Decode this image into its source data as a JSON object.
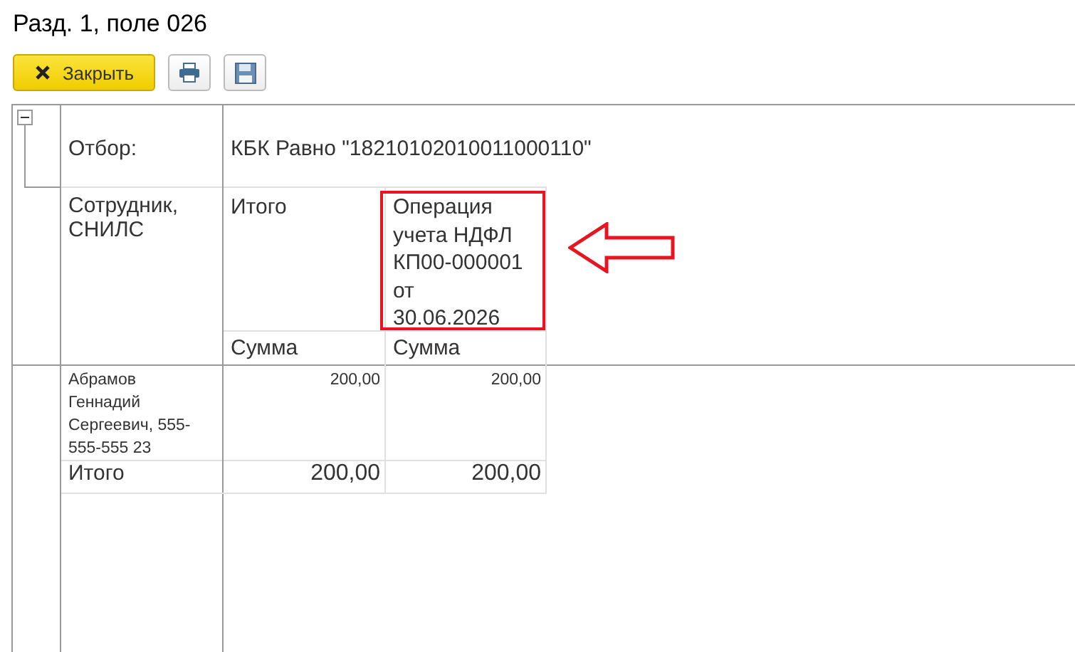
{
  "title": "Разд. 1, поле 026",
  "toolbar": [
    {
      "kind": "close",
      "label": "Закрыть"
    },
    {
      "kind": "print"
    },
    {
      "kind": "save"
    }
  ],
  "report": {
    "group_expanded": true,
    "filter_label": "Отбор:",
    "filter_value": "КБК Равно \"18210102010011000110\"",
    "row_header": "Сотрудник, СНИЛС",
    "columns": [
      {
        "title": "Итого",
        "measure": "Сумма",
        "highlighted": false
      },
      {
        "title": "Операция учета НДФЛ КП00-000001 от 30.06.2026",
        "measure": "Сумма",
        "highlighted": true
      }
    ],
    "rows": [
      {
        "name": "Абрамов Геннадий Сергеевич, 555-555-555 23",
        "values": [
          "200,00",
          "200,00"
        ]
      }
    ],
    "total": {
      "label": "Итого",
      "values": [
        "200,00",
        "200,00"
      ]
    }
  }
}
